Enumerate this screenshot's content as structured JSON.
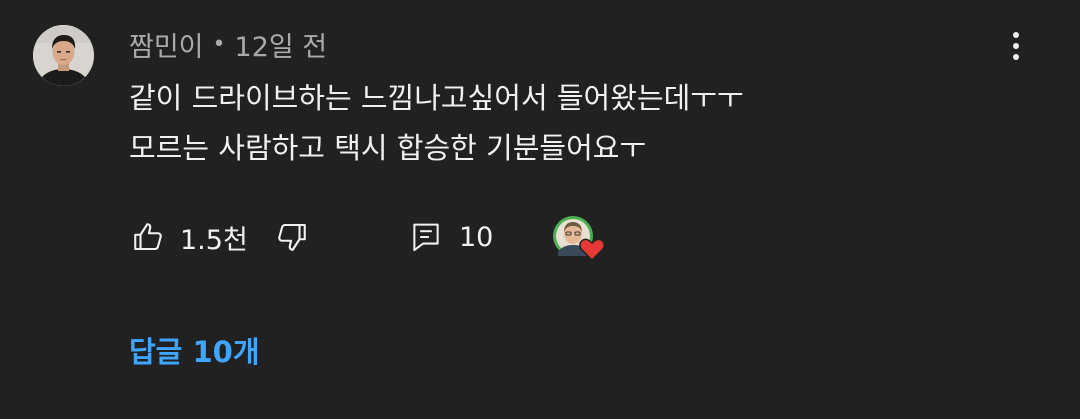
{
  "comment": {
    "author": "짬민이",
    "separator": "•",
    "time": "12일 전",
    "lines": [
      "같이 드라이브하는 느낌나고싶어서 들어왔는데ㅜㅜ",
      "모르는 사람하고 택시 합승한 기분들어요ㅜ"
    ]
  },
  "actions": {
    "like_count": "1.5천",
    "reply_count": "10",
    "icons": {
      "like": "thumbs-up-icon",
      "dislike": "thumbs-down-icon",
      "reply": "comment-icon",
      "more": "more-vertical-icon",
      "creator_heart": "heart-icon"
    }
  },
  "replies": {
    "label": "답글 10개"
  },
  "colors": {
    "background": "#212121",
    "text": "#f1f1f1",
    "secondary": "#aaaaaa",
    "link": "#3ea6ff",
    "heart": "#e53935",
    "creator_ring": "#4caf50"
  }
}
